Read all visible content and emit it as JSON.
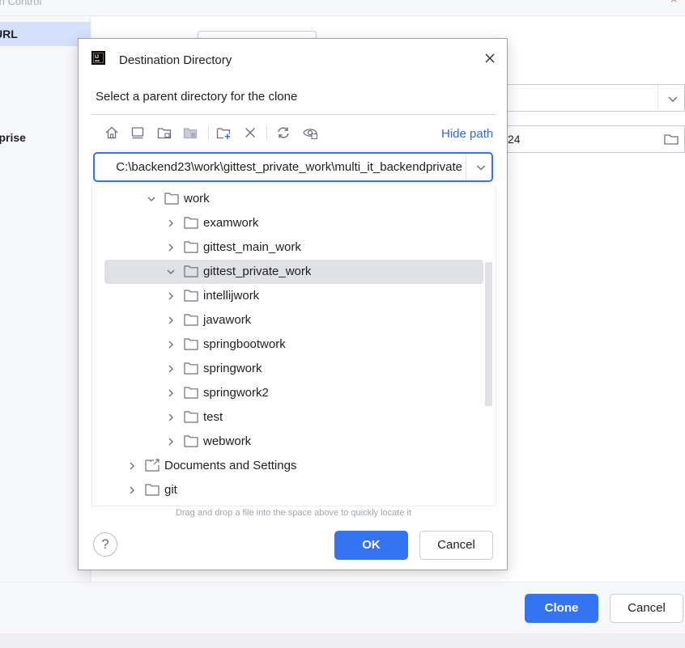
{
  "background": {
    "title": "sion Control",
    "sidebar_items": [
      {
        "label": "URL",
        "selected": true
      },
      {
        "label": "rprise",
        "selected": false
      }
    ],
    "directory_value": "24",
    "clone_label": "Clone",
    "cancel_label": "Cancel"
  },
  "dialog": {
    "title": "Destination Directory",
    "description": "Select a parent directory for the clone",
    "hide_path_label": "Hide path",
    "path_value": "C:\\backend23\\work\\gittest_private_work\\multi_it_backendprivate",
    "hint": "Drag and drop a file into the space above to quickly locate it",
    "help_label": "?",
    "ok_label": "OK",
    "cancel_label": "Cancel",
    "toolbar": [
      {
        "name": "home-icon"
      },
      {
        "name": "desktop-icon"
      },
      {
        "name": "project-folder-icon"
      },
      {
        "name": "module-folder-icon"
      },
      {
        "name": "new-folder-icon"
      },
      {
        "name": "delete-icon"
      },
      {
        "name": "refresh-icon"
      },
      {
        "name": "show-hidden-icon"
      }
    ],
    "tree": [
      {
        "label": "work",
        "expanded": true,
        "type": "folder"
      },
      {
        "label": "examwork",
        "expanded": false,
        "type": "folder"
      },
      {
        "label": "gittest_main_work",
        "expanded": false,
        "type": "folder"
      },
      {
        "label": "gittest_private_work",
        "expanded": true,
        "selected": true,
        "type": "folder"
      },
      {
        "label": "intellijwork",
        "expanded": false,
        "type": "folder"
      },
      {
        "label": "javawork",
        "expanded": false,
        "type": "folder"
      },
      {
        "label": "springbootwork",
        "expanded": false,
        "type": "folder"
      },
      {
        "label": "springwork",
        "expanded": false,
        "type": "folder"
      },
      {
        "label": "springwork2",
        "expanded": false,
        "type": "folder"
      },
      {
        "label": "test",
        "expanded": false,
        "type": "folder"
      },
      {
        "label": "webwork",
        "expanded": false,
        "type": "folder"
      },
      {
        "label": "Documents and Settings",
        "expanded": false,
        "type": "link-folder"
      },
      {
        "label": "git",
        "expanded": false,
        "type": "folder"
      }
    ]
  },
  "colors": {
    "accent": "#3574f0",
    "link": "#2f6bdd",
    "selection": "#dfe1e5",
    "sidebar_selection": "#d5e1fb"
  }
}
